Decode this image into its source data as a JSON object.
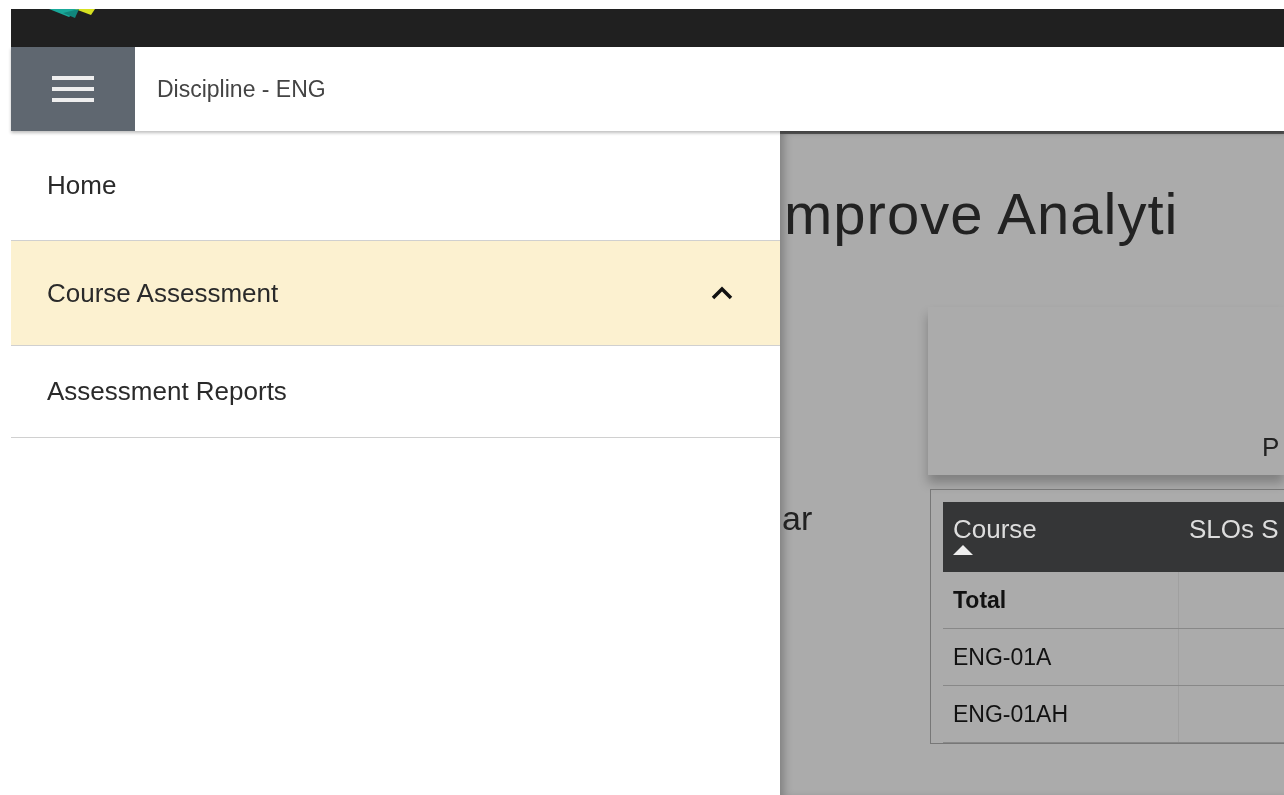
{
  "header": {
    "title": "Discipline - ENG"
  },
  "menu": [
    {
      "label": "Home",
      "kind": "link",
      "selected": false
    },
    {
      "label": "Course Assessment",
      "kind": "group",
      "selected": true,
      "expanded": true
    },
    {
      "label": "Assessment Reports",
      "kind": "link",
      "selected": false
    }
  ],
  "background": {
    "title": "mprove Analyti",
    "card_text": "P",
    "side_text": "ar",
    "table": {
      "columns": [
        {
          "label": "Course",
          "sorted": true
        },
        {
          "label": "SLOs S",
          "sorted": false
        }
      ],
      "rows": [
        {
          "cells": [
            "Total"
          ],
          "kind": "total"
        },
        {
          "cells": [
            "ENG-01A"
          ],
          "kind": "course"
        },
        {
          "cells": [
            "ENG-01AH"
          ],
          "kind": "course"
        }
      ]
    }
  }
}
